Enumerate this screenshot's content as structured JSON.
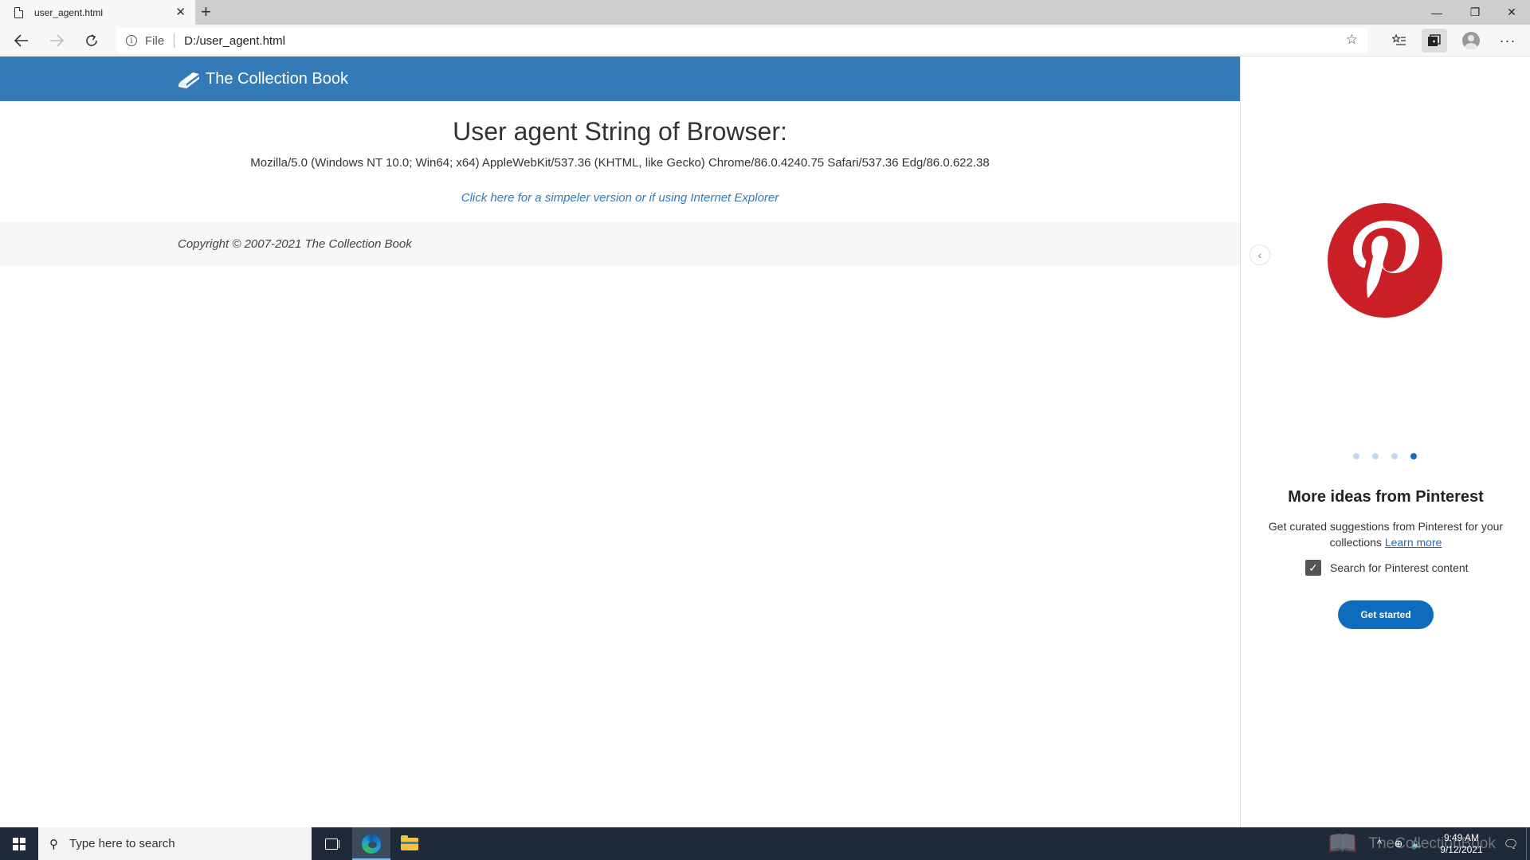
{
  "browser": {
    "tab_title": "user_agent.html",
    "tab_close": "✕",
    "new_tab": "+",
    "address_scheme": "File",
    "address_url": "D:/user_agent.html",
    "window_controls": {
      "minimize": "—",
      "restore": "❐",
      "close": "✕"
    }
  },
  "site": {
    "brand": "The Collection Book",
    "title": "User agent String of Browser:",
    "user_agent": "Mozilla/5.0 (Windows NT 10.0; Win64; x64) AppleWebKit/537.36 (KHTML, like Gecko) Chrome/86.0.4240.75 Safari/537.36 Edg/86.0.622.38",
    "simple_link": "Click here for a simpeler version or if using Internet Explorer",
    "copyright": "Copyright © 2007-2021 The Collection Book"
  },
  "collections_pane": {
    "back": "‹",
    "title": "More ideas from Pinterest",
    "description": "Get curated suggestions from Pinterest for your collections",
    "learn_more": "Learn more",
    "checkbox_label": "Search for Pinterest content",
    "checkbox_checked": true,
    "button": "Get started",
    "carousel": {
      "total": 4,
      "active": 4
    },
    "brand_color": "#cb1f27"
  },
  "taskbar": {
    "search_placeholder": "Type here to search",
    "time": "9:49 AM",
    "date": "9/12/2021",
    "watermark": "TheCollectionBook"
  },
  "colors": {
    "header_blue": "#337ab7",
    "taskbar": "#1f2a38",
    "button_blue": "#0f6cbd"
  }
}
